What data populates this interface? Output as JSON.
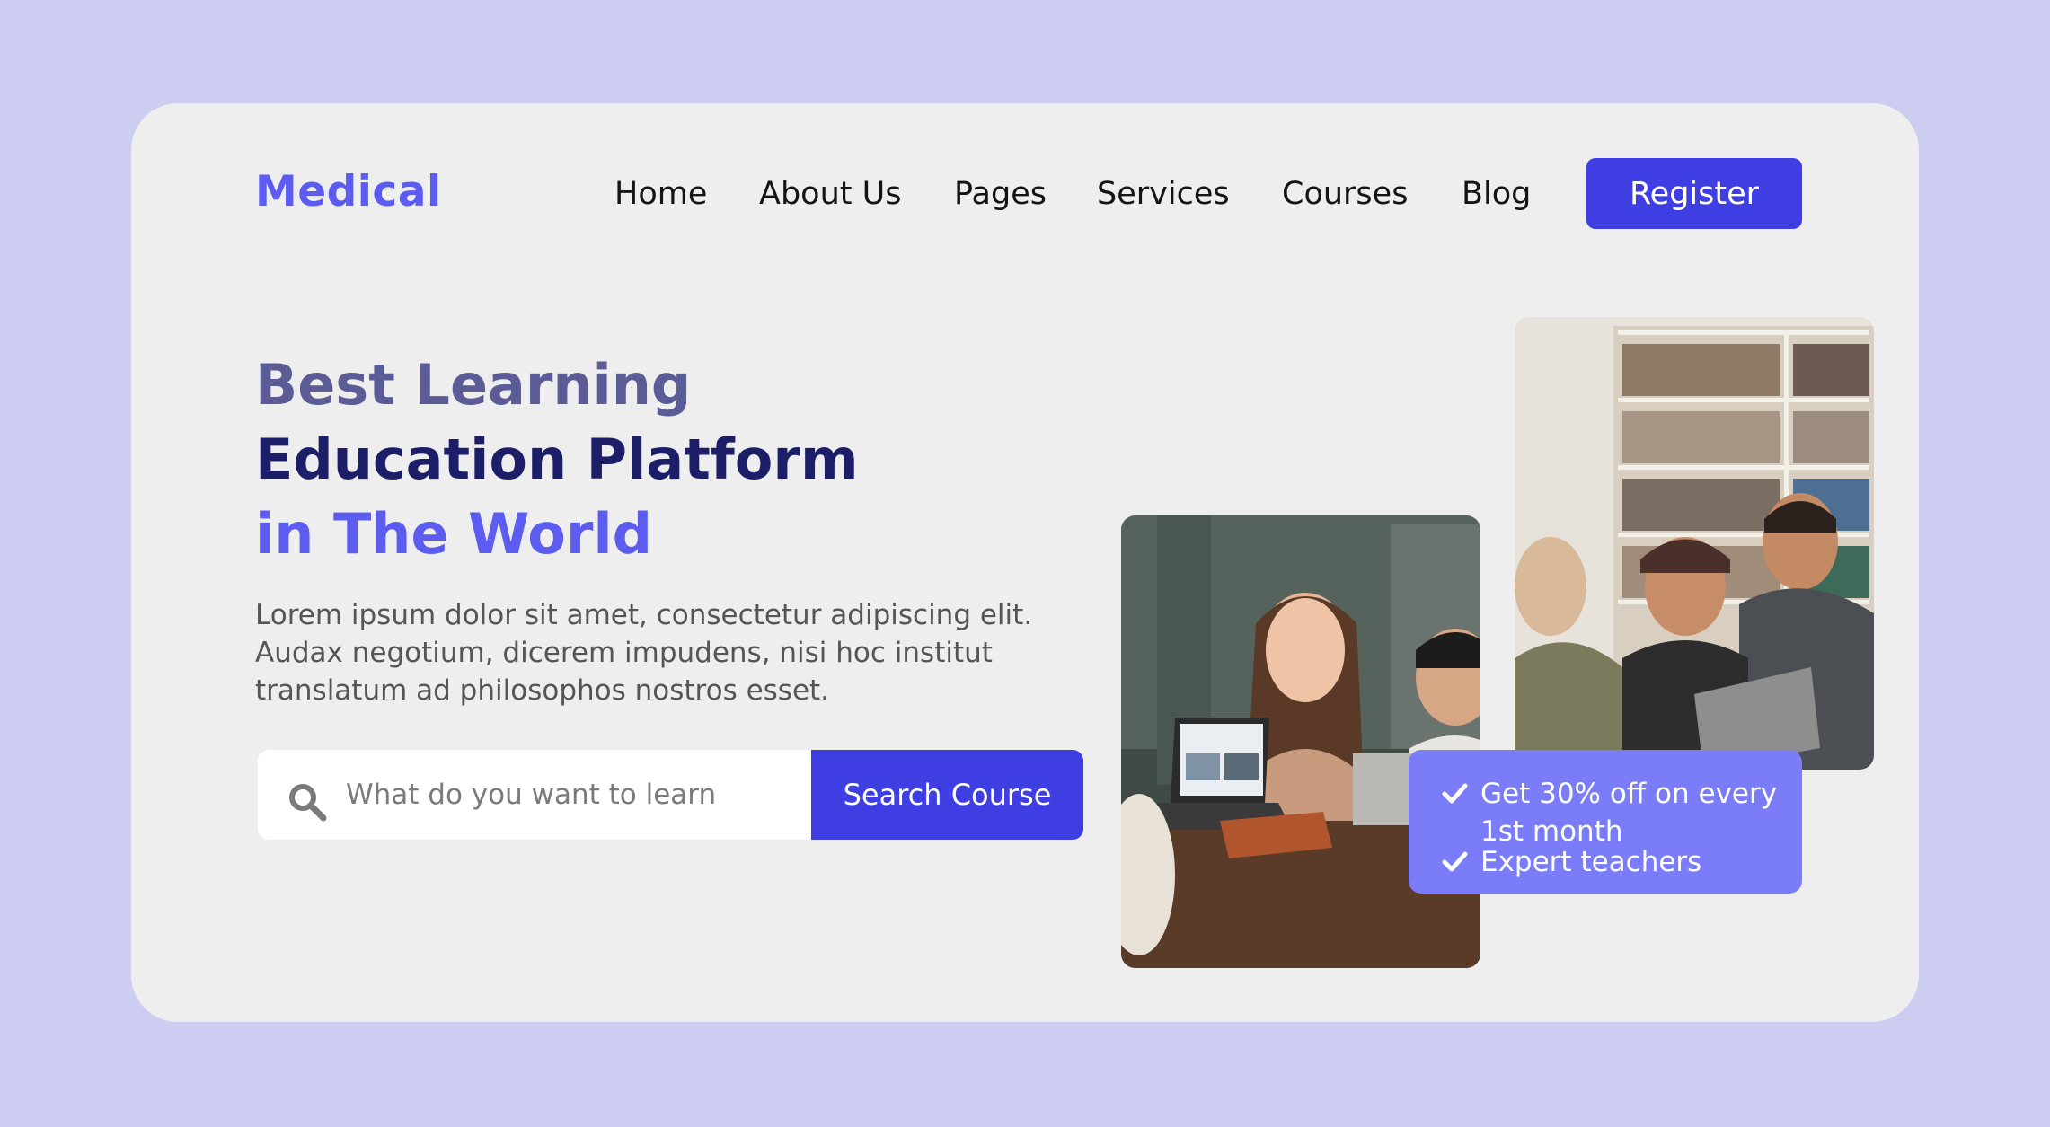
{
  "brand": {
    "logo": "Medical"
  },
  "nav": {
    "items": [
      {
        "label": "Home"
      },
      {
        "label": "About Us"
      },
      {
        "label": "Pages"
      },
      {
        "label": "Services"
      },
      {
        "label": "Courses"
      },
      {
        "label": "Blog"
      }
    ],
    "register_label": "Register"
  },
  "hero": {
    "line1": "Best Learning",
    "line2": "Education Platform",
    "line3": "in The World",
    "description": "Lorem ipsum dolor sit amet, consectetur adipiscing elit. Audax negotium, dicerem impudens, nisi hoc institut translatum ad philosophos nostros esset."
  },
  "search": {
    "placeholder": "What do you want to learn",
    "icon": "search-icon",
    "button_label": "Search Course"
  },
  "promo": {
    "items": [
      {
        "text": "Get 30% off on every 1st month",
        "icon": "check-icon"
      },
      {
        "text": "Expert teachers",
        "icon": "check-icon"
      }
    ]
  },
  "colors": {
    "background": "#cccdf1",
    "card": "#eeeeee",
    "accent": "#3e3ee2",
    "brand": "#5c5cf1",
    "promo": "#7a7cf8",
    "heading_dark": "#1c1f68",
    "heading_muted": "#5b5b96"
  }
}
